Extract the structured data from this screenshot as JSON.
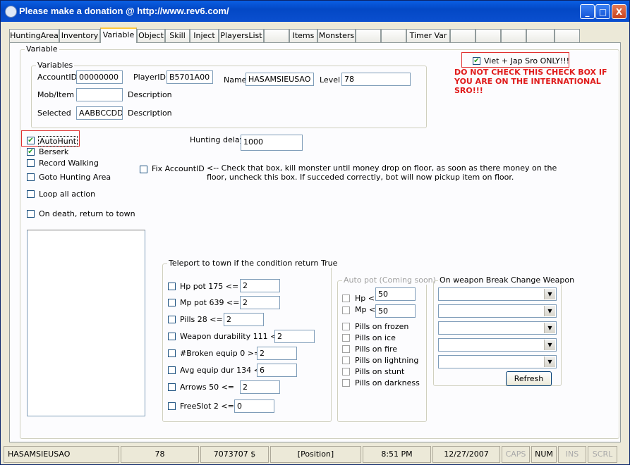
{
  "window": {
    "title": "Please make a donation @ http://www.rev6.com/",
    "min_label": "_",
    "max_label": "□",
    "close_label": "X"
  },
  "tabs": [
    {
      "label": "HuntingArea"
    },
    {
      "label": "Inventory"
    },
    {
      "label": "Variable"
    },
    {
      "label": "Object"
    },
    {
      "label": "Skill"
    },
    {
      "label": "Inject"
    },
    {
      "label": "PlayersList"
    },
    {
      "label": ""
    },
    {
      "label": "Items"
    },
    {
      "label": "Monsters"
    },
    {
      "label": ""
    },
    {
      "label": ""
    },
    {
      "label": "Timer Var"
    },
    {
      "label": ""
    },
    {
      "label": ""
    },
    {
      "label": ""
    },
    {
      "label": ""
    },
    {
      "label": ""
    }
  ],
  "variable_group": {
    "label": "Variable"
  },
  "variables": {
    "label": "Variables",
    "account_id_label": "AccountID",
    "account_id": "00000000",
    "player_id_label": "PlayerID",
    "player_id": "B5701A00",
    "name_label": "Name",
    "name": "HASAMSIEUSAO",
    "level_label": "Level",
    "level": "78",
    "mob_item_label": "Mob/Item",
    "mob_item": "",
    "description1": "Description",
    "selected_label": "Selected",
    "selected": "AABBCCDD",
    "description2": "Description"
  },
  "viet_jap": {
    "label": "Viet + Jap Sro ONLY!!!",
    "checked": true
  },
  "warning": "DO NOT CHECK THIS CHECK BOX IF YOU ARE ON THE INTERNATIONAL SRO!!!",
  "options": {
    "autohunt": "AutoHunt",
    "berserk": "Berserk",
    "record_walking": "Record Walking",
    "goto_hunting": "Goto Hunting Area",
    "loop_all": "Loop all action",
    "on_death": "On death, return to town"
  },
  "hunting_delay": {
    "label": "Hunting delay",
    "value": "1000"
  },
  "fix_account": {
    "label": "Fix AccountID",
    "note": "<-- Check that box, kill monster until money drop on floor, as soon as there money on the floor, uncheck this box. If succeded correctly, bot will now pickup item on floor."
  },
  "teleport": {
    "label": "Teleport to town if the condition return True",
    "rows": [
      {
        "label": "Hp pot 175 <=",
        "value": "2"
      },
      {
        "label": "Mp pot 639 <=",
        "value": "2"
      },
      {
        "label": "Pills 28 <=",
        "value": "2"
      },
      {
        "label": "Weapon durability 111 <=",
        "value": "2"
      },
      {
        "label": "#Broken equip 0 >=",
        "value": "2"
      },
      {
        "label": "Avg equip dur 134 <=",
        "value": "6"
      },
      {
        "label": "Arrows 50 <=",
        "value": "2"
      },
      {
        "label": "FreeSlot 2 <=",
        "value": "0"
      }
    ]
  },
  "autopot": {
    "label": "Auto pot (Coming soon)",
    "hp_label": "Hp <",
    "hp_value": "50",
    "mp_label": "Mp <",
    "mp_value": "50",
    "pills": [
      "Pills on frozen",
      "Pills on ice",
      "Pills on fire",
      "Pills on lightning",
      "Pills on stunt",
      "Pills on darkness"
    ]
  },
  "weapon": {
    "label": "On weapon Break Change Weapon",
    "refresh_label": "Refresh"
  },
  "status": {
    "name": "HASAMSIEUSAO",
    "level": "78",
    "gold": "7073707 $",
    "position": "[Position]",
    "time": "8:51 PM",
    "date": "12/27/2007",
    "caps": "CAPS",
    "num": "NUM",
    "ins": "INS",
    "scrl": "SCRL"
  }
}
